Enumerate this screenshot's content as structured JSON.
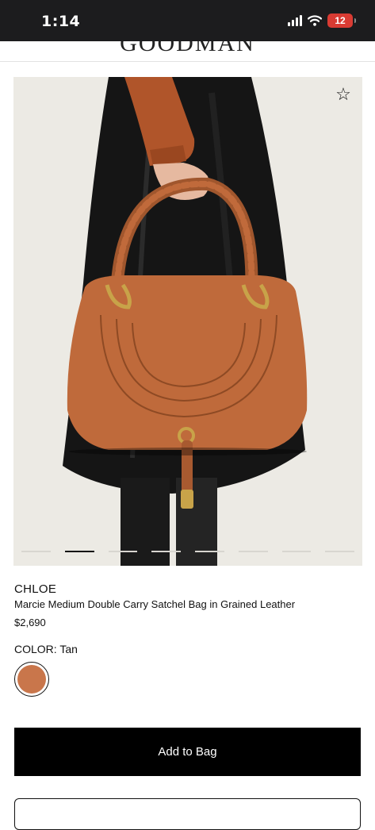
{
  "status_bar": {
    "time": "1:14",
    "battery_level": "12"
  },
  "header": {
    "logo": "GOODMAN"
  },
  "product": {
    "image_alt": "Tan leather handbag held in hand",
    "brand": "CHLOE",
    "name": "Marcie Medium Double Carry Satchel Bag in Grained Leather",
    "price": "$2,690",
    "color_label": "COLOR: Tan",
    "swatch_color": "#c9764b",
    "carousel_active_index": 1,
    "carousel_count": 8
  },
  "actions": {
    "add_to_bag": "Add to Bag"
  },
  "colors": {
    "accent": "#000000",
    "swatch_tan": "#c9764b"
  }
}
